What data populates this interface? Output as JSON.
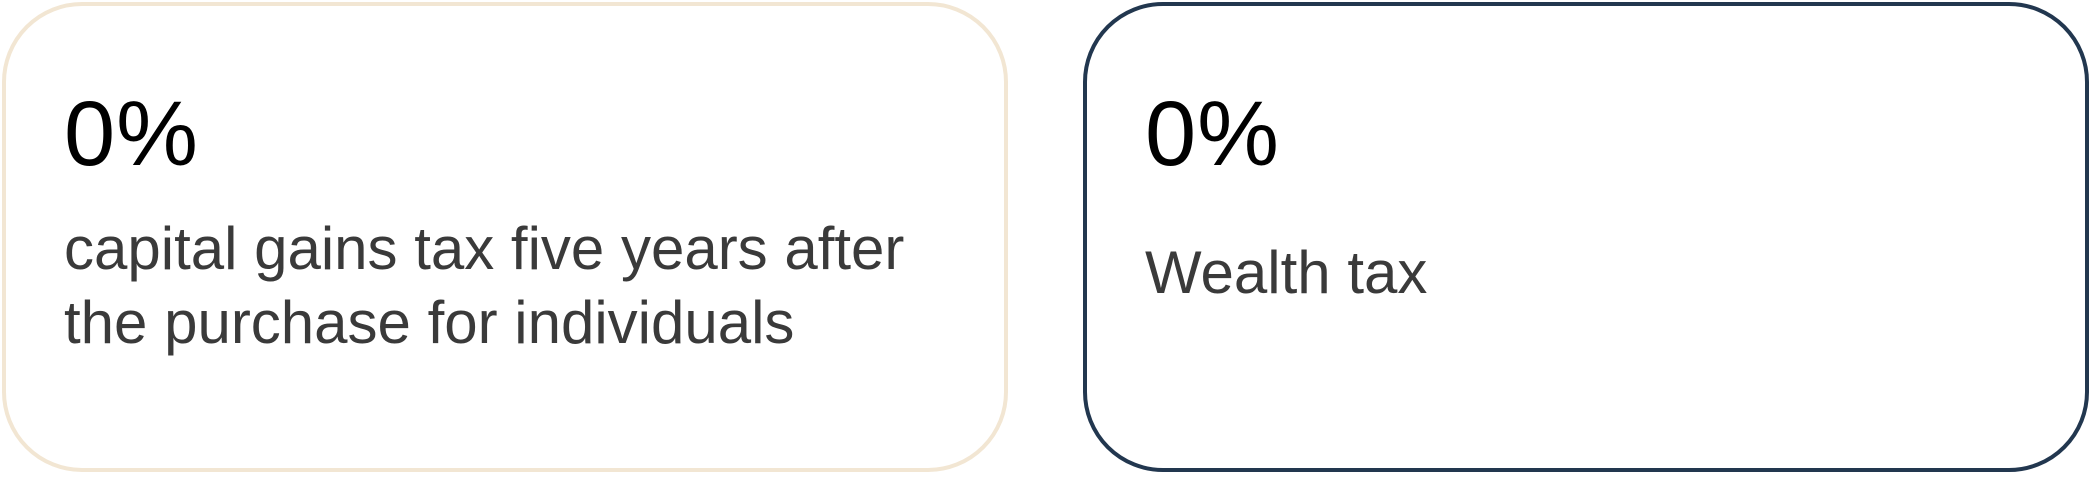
{
  "cards": [
    {
      "value": "0%",
      "label": "capital gains tax five years after the purchase for individuals",
      "border_color": "#f2e6d3"
    },
    {
      "value": "0%",
      "label": "Wealth tax",
      "border_color": "#22374f"
    }
  ]
}
